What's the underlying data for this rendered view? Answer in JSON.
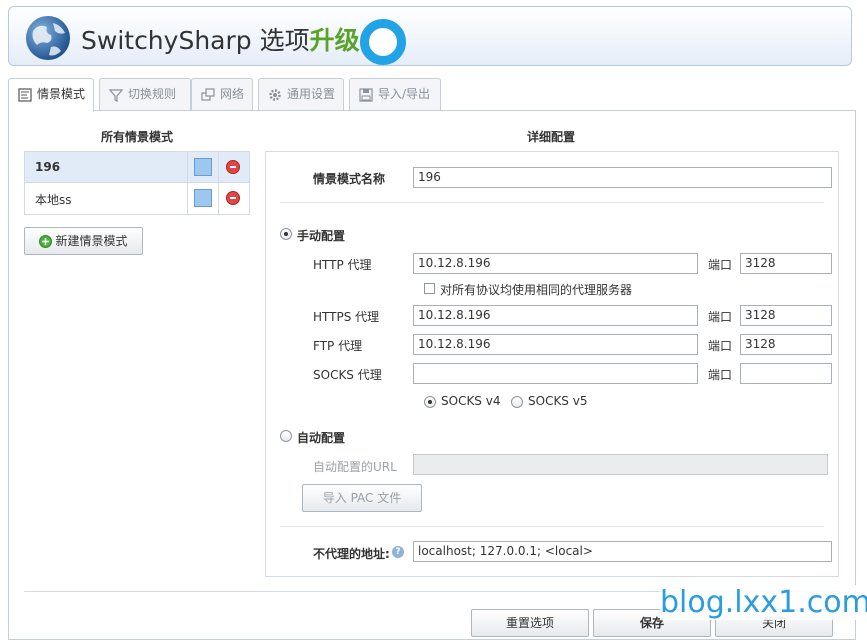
{
  "app": {
    "title_main": "SwitchySharp 选项",
    "title_highlight": "升级"
  },
  "tabs": [
    {
      "label": "情景模式",
      "active": true
    },
    {
      "label": "切换规则",
      "active": false
    },
    {
      "label": "网络",
      "active": false
    },
    {
      "label": "通用设置",
      "active": false
    },
    {
      "label": "导入/导出",
      "active": false
    }
  ],
  "profiles": {
    "header": "所有情景模式",
    "items": [
      {
        "name": "196",
        "selected": true,
        "color": "#9cc8ef"
      },
      {
        "name": "本地ss",
        "selected": false,
        "color": "#9cc8ef"
      }
    ],
    "new_button": "新建情景模式"
  },
  "details": {
    "header": "详细配置",
    "profile_name_label": "情景模式名称",
    "profile_name_value": "196",
    "manual": {
      "label": "手动配置",
      "selected": true,
      "http_label": "HTTP 代理",
      "http_value": "10.12.8.196",
      "http_port": "3128",
      "same_proxy_label": "对所有协议均使用相同的代理服务器",
      "same_proxy_checked": false,
      "https_label": "HTTPS 代理",
      "https_value": "10.12.8.196",
      "https_port": "3128",
      "ftp_label": "FTP 代理",
      "ftp_value": "10.12.8.196",
      "ftp_port": "3128",
      "socks_label": "SOCKS 代理",
      "socks_value": "",
      "socks_port": "",
      "port_label": "端口",
      "socks_v4": "SOCKS v4",
      "socks_v5": "SOCKS v5",
      "socks_version_selected": "SOCKS v4"
    },
    "auto": {
      "label": "自动配置",
      "selected": false,
      "url_label": "自动配置的URL",
      "url_value": "",
      "import_pac_button": "导入 PAC 文件"
    },
    "bypass_label": "不代理的地址:",
    "bypass_value": "localhost; 127.0.0.1; <local>"
  },
  "footer": {
    "reset_button": "重置选项",
    "save_button": "保存",
    "close_button": "关闭"
  },
  "watermark": "blog.lxx1.com",
  "colors": {
    "accent": "#22a3e6",
    "highlight_green": "#5aa32a",
    "selected_row": "#e1eaf7"
  }
}
